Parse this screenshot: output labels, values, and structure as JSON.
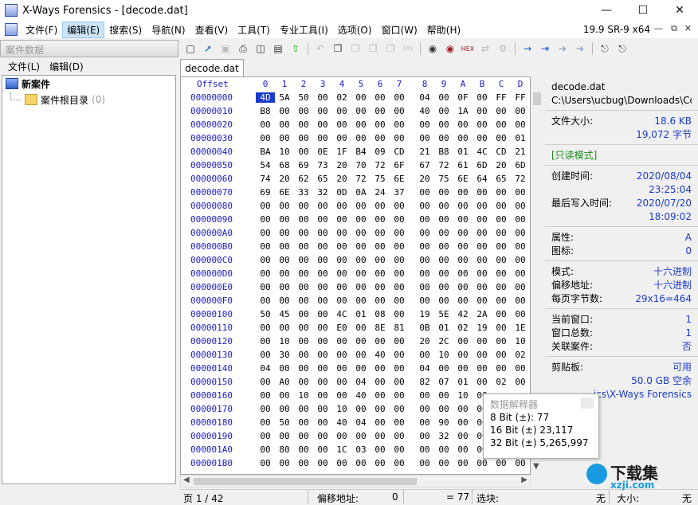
{
  "window": {
    "title": "X-Ways Forensics - [decode.dat]"
  },
  "menu": {
    "items": [
      "文件(F)",
      "编辑(E)",
      "搜索(S)",
      "导航(N)",
      "查看(V)",
      "工具(T)",
      "专业工具(I)",
      "选项(O)",
      "窗口(W)",
      "帮助(H)"
    ],
    "active_index": 1,
    "version": "19.9 SR-9 x64"
  },
  "left_panel": {
    "header": "案件数据",
    "menu": [
      "文件(L)",
      "编辑(D)"
    ],
    "tree": [
      {
        "label": "新案件",
        "icon": "case-icon"
      },
      {
        "label": "案件根目录",
        "count": "(0)",
        "icon": "folder-icon"
      }
    ]
  },
  "tab": {
    "label": "decode.dat"
  },
  "hex": {
    "offset_label": "Offset",
    "columns": [
      "0",
      "1",
      "2",
      "3",
      "4",
      "5",
      "6",
      "7",
      "8",
      "9",
      "A",
      "B",
      "C",
      "D"
    ],
    "rows": [
      {
        "offset": "00000000",
        "bytes": [
          "4D",
          "5A",
          "50",
          "00",
          "02",
          "00",
          "00",
          "00",
          "04",
          "00",
          "0F",
          "00",
          "FF",
          "FF"
        ]
      },
      {
        "offset": "00000010",
        "bytes": [
          "B8",
          "00",
          "00",
          "00",
          "00",
          "00",
          "00",
          "00",
          "40",
          "00",
          "1A",
          "00",
          "00",
          "00"
        ]
      },
      {
        "offset": "00000020",
        "bytes": [
          "00",
          "00",
          "00",
          "00",
          "00",
          "00",
          "00",
          "00",
          "00",
          "00",
          "00",
          "00",
          "00",
          "00"
        ]
      },
      {
        "offset": "00000030",
        "bytes": [
          "00",
          "00",
          "00",
          "00",
          "00",
          "00",
          "00",
          "00",
          "00",
          "00",
          "00",
          "00",
          "00",
          "01"
        ]
      },
      {
        "offset": "00000040",
        "bytes": [
          "BA",
          "10",
          "00",
          "0E",
          "1F",
          "B4",
          "09",
          "CD",
          "21",
          "B8",
          "01",
          "4C",
          "CD",
          "21"
        ]
      },
      {
        "offset": "00000050",
        "bytes": [
          "54",
          "68",
          "69",
          "73",
          "20",
          "70",
          "72",
          "6F",
          "67",
          "72",
          "61",
          "6D",
          "20",
          "6D"
        ]
      },
      {
        "offset": "00000060",
        "bytes": [
          "74",
          "20",
          "62",
          "65",
          "20",
          "72",
          "75",
          "6E",
          "20",
          "75",
          "6E",
          "64",
          "65",
          "72"
        ]
      },
      {
        "offset": "00000070",
        "bytes": [
          "69",
          "6E",
          "33",
          "32",
          "0D",
          "0A",
          "24",
          "37",
          "00",
          "00",
          "00",
          "00",
          "00",
          "00"
        ]
      },
      {
        "offset": "00000080",
        "bytes": [
          "00",
          "00",
          "00",
          "00",
          "00",
          "00",
          "00",
          "00",
          "00",
          "00",
          "00",
          "00",
          "00",
          "00"
        ]
      },
      {
        "offset": "00000090",
        "bytes": [
          "00",
          "00",
          "00",
          "00",
          "00",
          "00",
          "00",
          "00",
          "00",
          "00",
          "00",
          "00",
          "00",
          "00"
        ]
      },
      {
        "offset": "000000A0",
        "bytes": [
          "00",
          "00",
          "00",
          "00",
          "00",
          "00",
          "00",
          "00",
          "00",
          "00",
          "00",
          "00",
          "00",
          "00"
        ]
      },
      {
        "offset": "000000B0",
        "bytes": [
          "00",
          "00",
          "00",
          "00",
          "00",
          "00",
          "00",
          "00",
          "00",
          "00",
          "00",
          "00",
          "00",
          "00"
        ]
      },
      {
        "offset": "000000C0",
        "bytes": [
          "00",
          "00",
          "00",
          "00",
          "00",
          "00",
          "00",
          "00",
          "00",
          "00",
          "00",
          "00",
          "00",
          "00"
        ]
      },
      {
        "offset": "000000D0",
        "bytes": [
          "00",
          "00",
          "00",
          "00",
          "00",
          "00",
          "00",
          "00",
          "00",
          "00",
          "00",
          "00",
          "00",
          "00"
        ]
      },
      {
        "offset": "000000E0",
        "bytes": [
          "00",
          "00",
          "00",
          "00",
          "00",
          "00",
          "00",
          "00",
          "00",
          "00",
          "00",
          "00",
          "00",
          "00"
        ]
      },
      {
        "offset": "000000F0",
        "bytes": [
          "00",
          "00",
          "00",
          "00",
          "00",
          "00",
          "00",
          "00",
          "00",
          "00",
          "00",
          "00",
          "00",
          "00"
        ]
      },
      {
        "offset": "00000100",
        "bytes": [
          "50",
          "45",
          "00",
          "00",
          "4C",
          "01",
          "08",
          "00",
          "19",
          "5E",
          "42",
          "2A",
          "00",
          "00"
        ]
      },
      {
        "offset": "00000110",
        "bytes": [
          "00",
          "00",
          "00",
          "00",
          "E0",
          "00",
          "8E",
          "81",
          "0B",
          "01",
          "02",
          "19",
          "00",
          "1E"
        ]
      },
      {
        "offset": "00000120",
        "bytes": [
          "00",
          "10",
          "00",
          "00",
          "00",
          "00",
          "00",
          "00",
          "20",
          "2C",
          "00",
          "00",
          "00",
          "10"
        ]
      },
      {
        "offset": "00000130",
        "bytes": [
          "00",
          "30",
          "00",
          "00",
          "00",
          "00",
          "40",
          "00",
          "00",
          "10",
          "00",
          "00",
          "00",
          "02"
        ]
      },
      {
        "offset": "00000140",
        "bytes": [
          "04",
          "00",
          "00",
          "00",
          "00",
          "00",
          "00",
          "00",
          "04",
          "00",
          "00",
          "00",
          "00",
          "00"
        ]
      },
      {
        "offset": "00000150",
        "bytes": [
          "00",
          "A0",
          "00",
          "00",
          "00",
          "04",
          "00",
          "00",
          "82",
          "07",
          "01",
          "00",
          "02",
          "00"
        ]
      },
      {
        "offset": "00000160",
        "bytes": [
          "00",
          "00",
          "10",
          "00",
          "00",
          "40",
          "00",
          "00",
          "00",
          "00",
          "10",
          "00",
          "",
          ""
        ]
      },
      {
        "offset": "00000170",
        "bytes": [
          "00",
          "00",
          "00",
          "00",
          "10",
          "00",
          "00",
          "00",
          "00",
          "00",
          "00",
          "00",
          "",
          ""
        ]
      },
      {
        "offset": "00000180",
        "bytes": [
          "00",
          "50",
          "00",
          "00",
          "40",
          "04",
          "00",
          "00",
          "00",
          "90",
          "00",
          "00",
          "",
          ""
        ]
      },
      {
        "offset": "00000190",
        "bytes": [
          "00",
          "00",
          "00",
          "00",
          "00",
          "00",
          "00",
          "00",
          "00",
          "32",
          "00",
          "00",
          "",
          ""
        ]
      },
      {
        "offset": "000001A0",
        "bytes": [
          "00",
          "80",
          "00",
          "00",
          "1C",
          "03",
          "00",
          "00",
          "00",
          "00",
          "00",
          "00",
          "",
          ""
        ]
      },
      {
        "offset": "000001B0",
        "bytes": [
          "00",
          "00",
          "00",
          "00",
          "00",
          "00",
          "00",
          "00",
          "00",
          "00",
          "00",
          "00",
          "00",
          "00"
        ]
      }
    ]
  },
  "info": {
    "filename": "decode.dat",
    "path": "C:\\Users\\ucbug\\Downloads\\Co",
    "file_size_label": "文件大小:",
    "file_size_kb": "18.6 KB",
    "file_size_bytes": "19,072 字节",
    "readonly": "[只读模式]",
    "created_label": "创建时间:",
    "created_date": "2020/08/04",
    "created_time": "23:25:04",
    "modified_label": "最后写入时间:",
    "modified_date": "2020/07/20",
    "modified_time": "18:09:02",
    "attr_label": "属性:",
    "attr_value": "A",
    "icon_label": "图标:",
    "icon_value": "0",
    "mode_label": "模式:",
    "mode_value": "十六进制",
    "offset_label": "偏移地址:",
    "offset_value": "十六进制",
    "bytes_per_page_label": "每页字节数:",
    "bytes_per_page_value": "29x16=464",
    "current_window_label": "当前窗口:",
    "current_window_value": "1",
    "total_windows_label": "窗口总数:",
    "total_windows_value": "1",
    "related_case_label": "关联案件:",
    "related_case_value": "否",
    "clipboard_label": "剪贴板:",
    "clipboard_value": "可用",
    "disk_free": "50.0 GB 空余",
    "program_dir": "ics\\X-Ways Forensics"
  },
  "popup": {
    "title": "数据解释器",
    "lines": [
      "8 Bit (±): 77",
      "16 Bit (±) 23,117",
      "32 Bit (±) 5,265,997"
    ]
  },
  "status": {
    "page": "页 1 / 42",
    "offset_label": "偏移地址:",
    "offset_value": "0",
    "value": "= 77",
    "selection_label": "选块:",
    "none_1": "无",
    "size_label": "大小:",
    "none_2": "无"
  },
  "watermark": {
    "brand": "下载集",
    "url": "xzji.com"
  }
}
